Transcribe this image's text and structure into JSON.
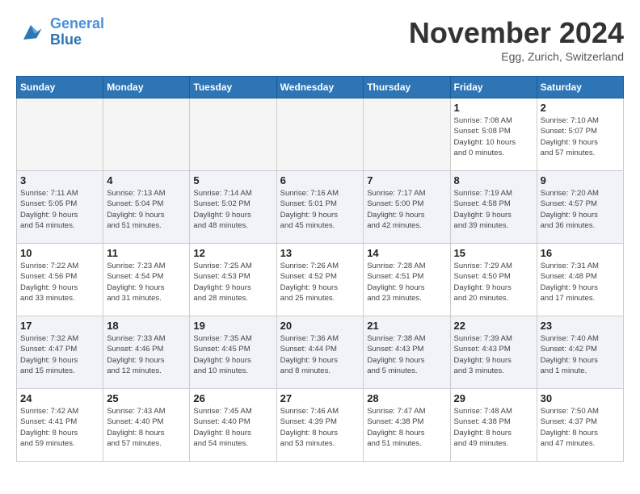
{
  "header": {
    "logo_line1": "General",
    "logo_line2": "Blue",
    "month_title": "November 2024",
    "location": "Egg, Zurich, Switzerland"
  },
  "weekdays": [
    "Sunday",
    "Monday",
    "Tuesday",
    "Wednesday",
    "Thursday",
    "Friday",
    "Saturday"
  ],
  "weeks": [
    [
      {
        "day": "",
        "empty": true
      },
      {
        "day": "",
        "empty": true
      },
      {
        "day": "",
        "empty": true
      },
      {
        "day": "",
        "empty": true
      },
      {
        "day": "",
        "empty": true
      },
      {
        "day": "1",
        "rise": "7:08 AM",
        "set": "5:08 PM",
        "hours": "10 hours",
        "mins": "0 minutes"
      },
      {
        "day": "2",
        "rise": "7:10 AM",
        "set": "5:07 PM",
        "hours": "9 hours",
        "mins": "57 minutes"
      }
    ],
    [
      {
        "day": "3",
        "rise": "7:11 AM",
        "set": "5:05 PM",
        "hours": "9 hours",
        "mins": "54 minutes"
      },
      {
        "day": "4",
        "rise": "7:13 AM",
        "set": "5:04 PM",
        "hours": "9 hours",
        "mins": "51 minutes"
      },
      {
        "day": "5",
        "rise": "7:14 AM",
        "set": "5:02 PM",
        "hours": "9 hours",
        "mins": "48 minutes"
      },
      {
        "day": "6",
        "rise": "7:16 AM",
        "set": "5:01 PM",
        "hours": "9 hours",
        "mins": "45 minutes"
      },
      {
        "day": "7",
        "rise": "7:17 AM",
        "set": "5:00 PM",
        "hours": "9 hours",
        "mins": "42 minutes"
      },
      {
        "day": "8",
        "rise": "7:19 AM",
        "set": "4:58 PM",
        "hours": "9 hours",
        "mins": "39 minutes"
      },
      {
        "day": "9",
        "rise": "7:20 AM",
        "set": "4:57 PM",
        "hours": "9 hours",
        "mins": "36 minutes"
      }
    ],
    [
      {
        "day": "10",
        "rise": "7:22 AM",
        "set": "4:56 PM",
        "hours": "9 hours",
        "mins": "33 minutes"
      },
      {
        "day": "11",
        "rise": "7:23 AM",
        "set": "4:54 PM",
        "hours": "9 hours",
        "mins": "31 minutes"
      },
      {
        "day": "12",
        "rise": "7:25 AM",
        "set": "4:53 PM",
        "hours": "9 hours",
        "mins": "28 minutes"
      },
      {
        "day": "13",
        "rise": "7:26 AM",
        "set": "4:52 PM",
        "hours": "9 hours",
        "mins": "25 minutes"
      },
      {
        "day": "14",
        "rise": "7:28 AM",
        "set": "4:51 PM",
        "hours": "9 hours",
        "mins": "23 minutes"
      },
      {
        "day": "15",
        "rise": "7:29 AM",
        "set": "4:50 PM",
        "hours": "9 hours",
        "mins": "20 minutes"
      },
      {
        "day": "16",
        "rise": "7:31 AM",
        "set": "4:48 PM",
        "hours": "9 hours",
        "mins": "17 minutes"
      }
    ],
    [
      {
        "day": "17",
        "rise": "7:32 AM",
        "set": "4:47 PM",
        "hours": "9 hours",
        "mins": "15 minutes"
      },
      {
        "day": "18",
        "rise": "7:33 AM",
        "set": "4:46 PM",
        "hours": "9 hours",
        "mins": "12 minutes"
      },
      {
        "day": "19",
        "rise": "7:35 AM",
        "set": "4:45 PM",
        "hours": "9 hours",
        "mins": "10 minutes"
      },
      {
        "day": "20",
        "rise": "7:36 AM",
        "set": "4:44 PM",
        "hours": "9 hours",
        "mins": "8 minutes"
      },
      {
        "day": "21",
        "rise": "7:38 AM",
        "set": "4:43 PM",
        "hours": "9 hours",
        "mins": "5 minutes"
      },
      {
        "day": "22",
        "rise": "7:39 AM",
        "set": "4:43 PM",
        "hours": "9 hours",
        "mins": "3 minutes"
      },
      {
        "day": "23",
        "rise": "7:40 AM",
        "set": "4:42 PM",
        "hours": "9 hours",
        "mins": "1 minute"
      }
    ],
    [
      {
        "day": "24",
        "rise": "7:42 AM",
        "set": "4:41 PM",
        "hours": "8 hours",
        "mins": "59 minutes"
      },
      {
        "day": "25",
        "rise": "7:43 AM",
        "set": "4:40 PM",
        "hours": "8 hours",
        "mins": "57 minutes"
      },
      {
        "day": "26",
        "rise": "7:45 AM",
        "set": "4:40 PM",
        "hours": "8 hours",
        "mins": "54 minutes"
      },
      {
        "day": "27",
        "rise": "7:46 AM",
        "set": "4:39 PM",
        "hours": "8 hours",
        "mins": "53 minutes"
      },
      {
        "day": "28",
        "rise": "7:47 AM",
        "set": "4:38 PM",
        "hours": "8 hours",
        "mins": "51 minutes"
      },
      {
        "day": "29",
        "rise": "7:48 AM",
        "set": "4:38 PM",
        "hours": "8 hours",
        "mins": "49 minutes"
      },
      {
        "day": "30",
        "rise": "7:50 AM",
        "set": "4:37 PM",
        "hours": "8 hours",
        "mins": "47 minutes"
      }
    ]
  ]
}
